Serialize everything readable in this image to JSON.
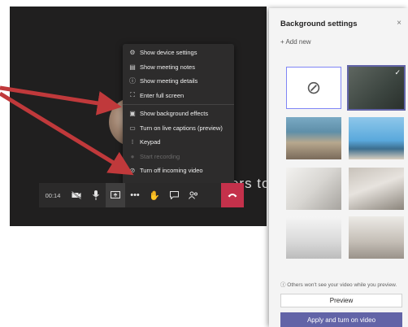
{
  "meeting": {
    "waiting_text": "Waiting for others to join...",
    "menu_items": [
      {
        "label": "Show device settings",
        "icon": "gear-icon",
        "disabled": false
      },
      {
        "label": "Show meeting notes",
        "icon": "notes-icon",
        "disabled": false
      },
      {
        "label": "Show meeting details",
        "icon": "info-icon",
        "disabled": false
      },
      {
        "label": "Enter full screen",
        "icon": "fullscreen-icon",
        "disabled": false
      },
      {
        "label": "Show background effects",
        "icon": "background-effects-icon",
        "disabled": false
      },
      {
        "label": "Turn on live captions (preview)",
        "icon": "captions-icon",
        "disabled": false
      },
      {
        "label": "Keypad",
        "icon": "keypad-icon",
        "disabled": false
      },
      {
        "label": "Start recording",
        "icon": "record-icon",
        "disabled": true
      },
      {
        "label": "Turn off incoming video",
        "icon": "video-off-icon",
        "disabled": false
      }
    ],
    "toolbar": {
      "time": "00:14",
      "icons": [
        "video-off-icon",
        "microphone-icon",
        "share-screen-icon",
        "more-options-icon",
        "raise-hand-icon",
        "chat-icon",
        "participants-icon",
        "hang-up-icon"
      ]
    }
  },
  "panel": {
    "title": "Background settings",
    "close": "×",
    "add_new": "+ Add new",
    "note": "ⓘ Others won't see your video while you preview.",
    "preview_label": "Preview",
    "apply_label": "Apply and turn on video",
    "check": "✓"
  },
  "colors": {
    "accent": "#6264a7",
    "hangup": "#c4314b",
    "arrow": "#c0393b",
    "meeting_bg": "#201f1f"
  }
}
